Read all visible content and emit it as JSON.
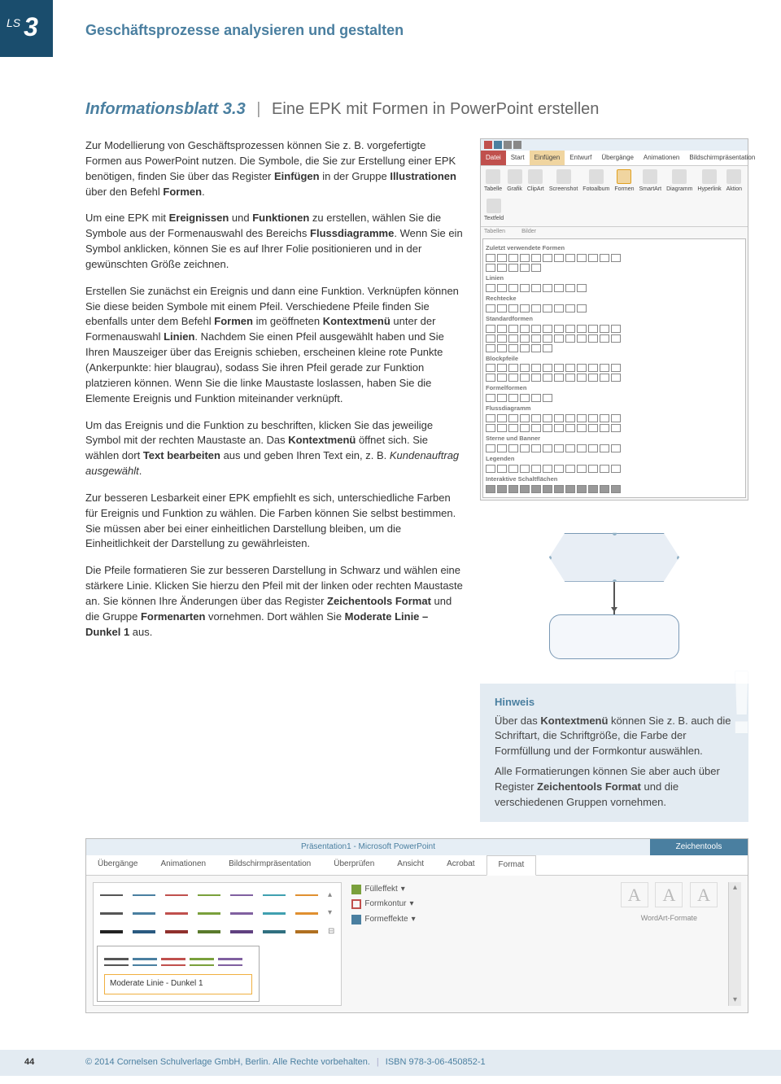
{
  "sideTab": {
    "ls": "LS",
    "num": "3"
  },
  "chapterTitle": "Geschäftsprozesse analysieren und gestalten",
  "sheet": {
    "title": "Informationsblatt 3.3",
    "subtitle": "Eine EPK mit Formen in PowerPoint erstellen"
  },
  "para1_a": "Zur Modellierung von Geschäftsprozessen können Sie z. B. vorgefertigte Formen aus PowerPoint nutzen. Die Symbole, die Sie zur Erstellung einer EPK benötigen, finden Sie über das Register ",
  "para1_b": "Einfügen",
  "para1_c": " in der Gruppe ",
  "para1_d": "Illustrationen",
  "para1_e": " über den Befehl ",
  "para1_f": "Formen",
  "para1_g": ".",
  "para2_a": "Um eine EPK mit ",
  "para2_b": "Ereignissen",
  "para2_c": " und ",
  "para2_d": "Funktionen",
  "para2_e": " zu erstellen, wählen Sie die Symbole aus der Formenauswahl des Bereichs ",
  "para2_f": "Flussdiagramme",
  "para2_g": ". Wenn Sie ein Symbol anklicken, können Sie es auf Ihrer Folie positionieren und in der gewünschten Größe zeichnen.",
  "para3_a": "Erstellen Sie zunächst ein Ereignis und dann eine Funktion. Verknüpfen können Sie diese beiden Symbole mit einem Pfeil. Verschiedene Pfeile finden Sie ebenfalls unter dem Befehl ",
  "para3_b": "Formen",
  "para3_c": " im geöffneten ",
  "para3_d": "Kontextmenü",
  "para3_e": " unter der Formenauswahl ",
  "para3_f": "Linien",
  "para3_g": ". Nachdem Sie einen Pfeil ausgewählt haben und Sie Ihren Mauszeiger über das Ereignis schieben, erscheinen kleine rote Punkte (Ankerpunkte: hier blaugrau), sodass Sie ihren Pfeil gerade zur Funktion platzieren können. Wenn Sie die linke Maustaste loslassen, haben Sie die Elemente Ereignis und Funktion miteinander verknüpft.",
  "para4_a": "Um das Ereignis und die Funktion zu beschriften, klicken Sie das jeweilige Symbol mit der rechten Maustaste an. Das ",
  "para4_b": "Kontextmenü",
  "para4_c": " öffnet sich. Sie wählen dort ",
  "para4_d": "Text bearbeiten",
  "para4_e": " aus und geben Ihren Text ein, z. B. ",
  "para4_f": "Kundenauftrag ausgewählt",
  "para4_g": ".",
  "para5": "Zur besseren Lesbarkeit einer EPK empfiehlt es sich, unterschiedliche Farben für Ereignis und Funktion zu wählen. Die Farben können Sie selbst bestimmen. Sie müssen aber bei einer einheitlichen Darstellung bleiben, um die Einheitlichkeit der Darstellung zu gewährleisten.",
  "para6_a": "Die Pfeile formatieren Sie zur besseren Darstellung in Schwarz und wählen eine stärkere Linie. Klicken Sie hierzu den Pfeil mit der linken oder rechten Maustaste an. Sie können Ihre Änderungen über das Register ",
  "para6_b": "Zeichentools Format",
  "para6_c": " und die Gruppe ",
  "para6_d": "Formenarten",
  "para6_e": " vornehmen. Dort wählen Sie ",
  "para6_f": "Moderate Linie – Dunkel 1",
  "para6_g": " aus.",
  "ribbon": {
    "tabs": [
      "Datei",
      "Start",
      "Einfügen",
      "Entwurf",
      "Übergänge",
      "Animationen",
      "Bildschirmpräsentation"
    ],
    "buttons": [
      "Tabelle",
      "Grafik",
      "ClipArt",
      "Screenshot",
      "Fotoalbum",
      "Formen",
      "SmartArt",
      "Diagramm",
      "Hyperlink",
      "Aktion",
      "Textfeld"
    ],
    "groups": [
      "Tabellen",
      "Bilder"
    ],
    "groups2_label": "Zuletzt verwendete Formen"
  },
  "shapeCats": {
    "linien": "Linien",
    "rechtecke": "Rechtecke",
    "standard": "Standardformen",
    "block": "Blockpfeile",
    "formel": "Formelformen",
    "fluss": "Flussdiagramm",
    "sterne": "Sterne und Banner",
    "legenden": "Legenden",
    "interaktiv": "Interaktive Schaltflächen"
  },
  "hinweis": {
    "title": "Hinweis",
    "t1a": "Über das ",
    "t1b": "Kontextmenü",
    "t1c": " können Sie z. B. auch die Schriftart, die Schriftgröße, die Farbe der Formfüllung und der Formkontur auswählen.",
    "t2a": "Alle Formatierungen können Sie aber auch über Register ",
    "t2b": "Zeichentools Format",
    "t2c": " und die verschiedenen Gruppen vornehmen."
  },
  "bottom": {
    "title1": "Präsentation1  -  Microsoft PowerPoint",
    "title2": "Zeichentools",
    "tabs": [
      "Übergänge",
      "Animationen",
      "Bildschirmpräsentation",
      "Überprüfen",
      "Ansicht",
      "Acrobat",
      "Format"
    ],
    "fillOpts": [
      "Fülleffekt",
      "Formkontur",
      "Formeffekte"
    ],
    "waGroup": "WordArt-Formate",
    "pickerLabel": "Moderate Linie - Dunkel 1",
    "lineColors": [
      "#555",
      "#4a7fa0",
      "#c0504d",
      "#7aa03c",
      "#8060a0",
      "#40a0b0",
      "#e09030"
    ]
  },
  "footer": {
    "page": "44",
    "copyright": "© 2014 Cornelsen Schulverlage GmbH, Berlin. Alle Rechte vorbehalten.",
    "isbn": "ISBN 978-3-06-450852-1"
  }
}
